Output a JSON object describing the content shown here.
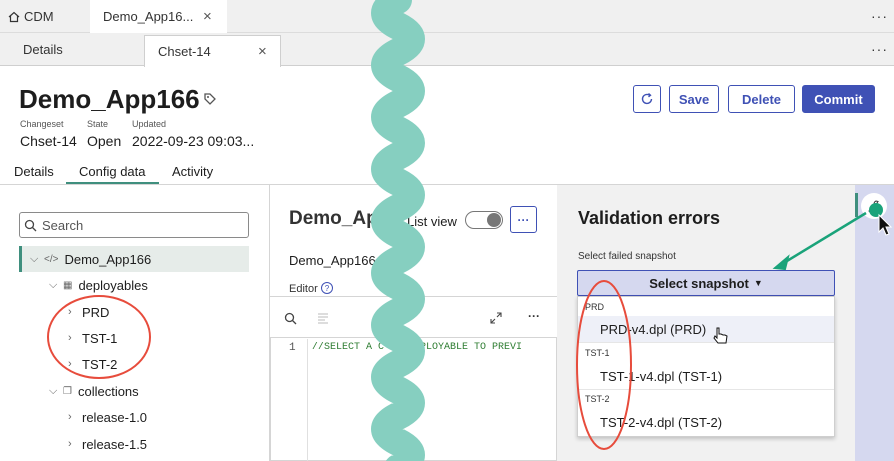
{
  "app_tabs": {
    "home_label": "CDM",
    "active_label": "Demo_App16...",
    "close_glyph": "×",
    "kebab": "···"
  },
  "sub_tabs": {
    "details_label": "Details",
    "active_label": "Chset-14",
    "close_glyph": "×",
    "kebab": "···"
  },
  "header": {
    "title": "Demo_App166",
    "changeset_label": "Changeset",
    "changeset_value": "Chset-14",
    "state_label": "State",
    "state_value": "Open",
    "updated_label": "Updated",
    "updated_value": "2022-09-23 09:03..."
  },
  "actions": {
    "save": "Save",
    "delete": "Delete",
    "commit": "Commit"
  },
  "page_tabs": [
    "Details",
    "Config data",
    "Activity"
  ],
  "tree": {
    "search_placeholder": "Search",
    "root": "Demo_App166",
    "deployables_label": "deployables",
    "deployables": [
      "PRD",
      "TST-1",
      "TST-2"
    ],
    "collections_label": "collections",
    "collections": [
      "release-1.0",
      "release-1.5"
    ]
  },
  "editor": {
    "title": "Demo_App",
    "list_view_label": "List view",
    "more": "···",
    "subtitle": "Demo_App166",
    "editor_label": "Editor",
    "help": "?",
    "line_number": "1",
    "code": "//SELECT A C     OR DEPLOYABLE TO PREVI"
  },
  "validation": {
    "title": "Validation errors",
    "select_label": "Select failed snapshot",
    "select_button": "Select snapshot",
    "groups": [
      {
        "name": "PRD",
        "item": "PRD-v4.dpl (PRD)"
      },
      {
        "name": "TST-1",
        "item": "TST-1-v4.dpl (TST-1)"
      },
      {
        "name": "TST-2",
        "item": "TST-2-v4.dpl (TST-2)"
      }
    ]
  },
  "colors": {
    "accent": "#3f51b5",
    "teal": "#3f8f7e",
    "annotation_red": "#e74c3c",
    "annotation_green": "#1aa37a",
    "squiggle": "#86cfc0"
  }
}
